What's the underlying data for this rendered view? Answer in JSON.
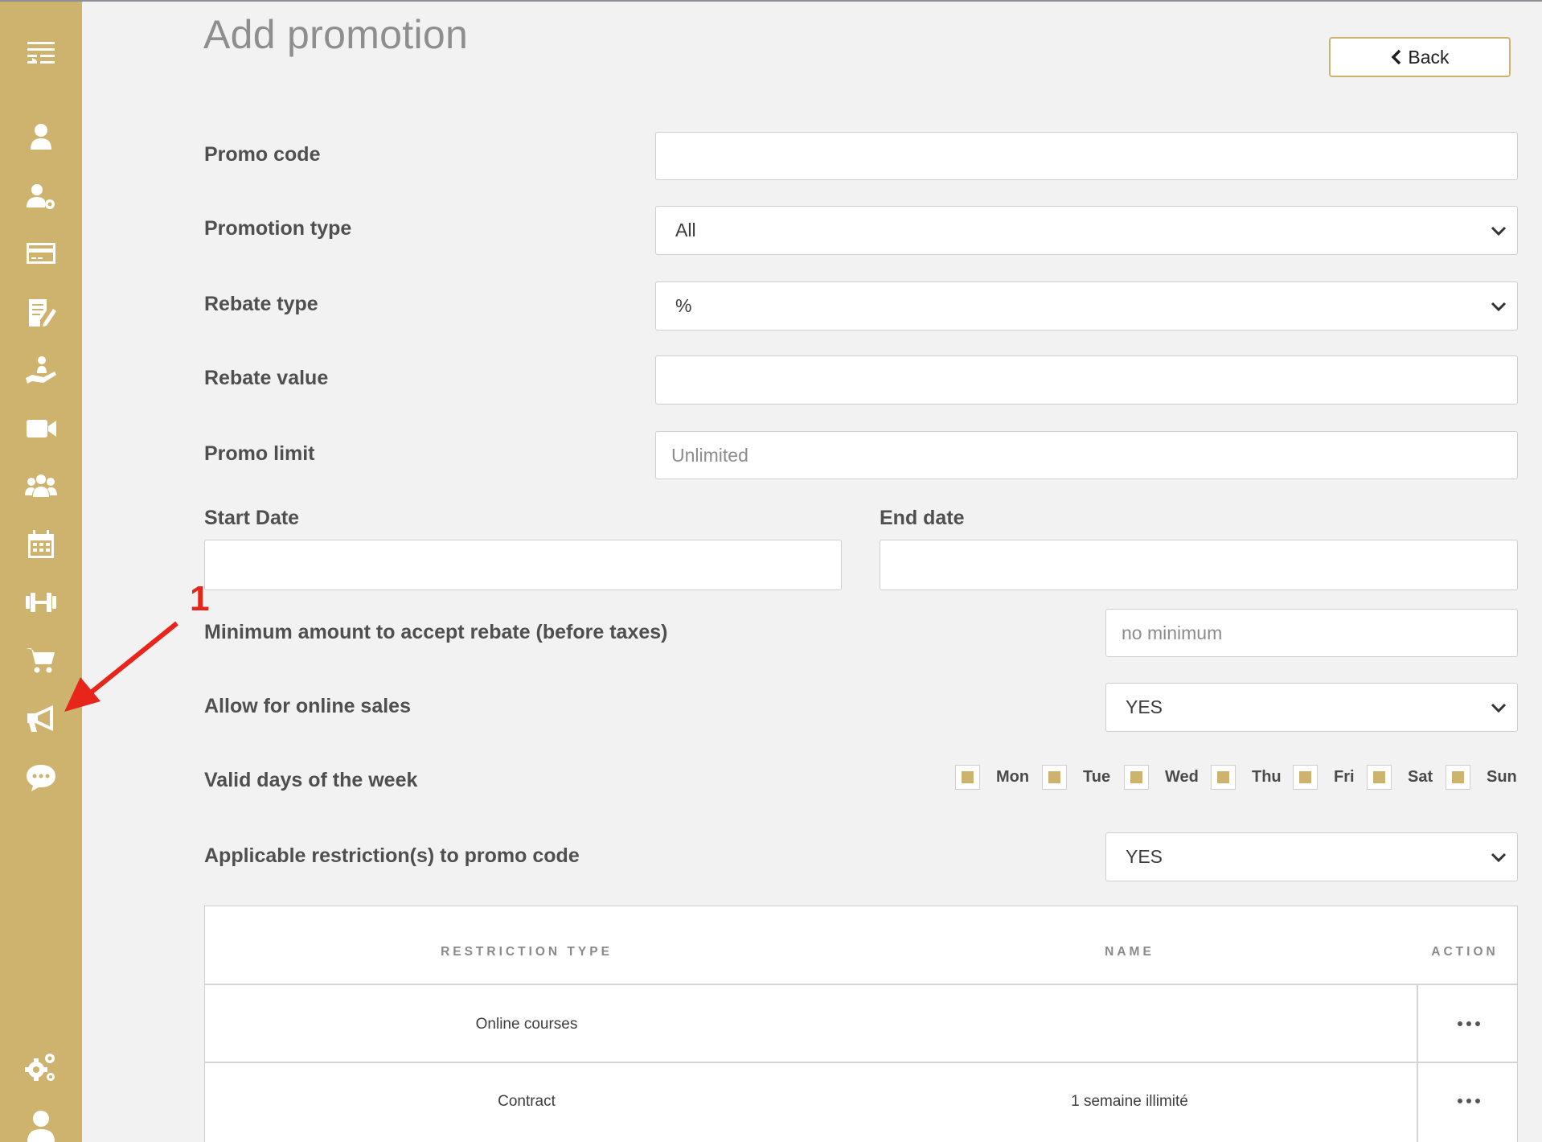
{
  "page": {
    "title": "Add promotion"
  },
  "header": {
    "back_label": "Back"
  },
  "sidebar": {
    "items": [
      {
        "icon": "menu-toggle-icon"
      },
      {
        "icon": "user-icon"
      },
      {
        "icon": "user-settings-icon"
      },
      {
        "icon": "credit-card-icon"
      },
      {
        "icon": "edit-document-icon"
      },
      {
        "icon": "hand-holding-person-icon"
      },
      {
        "icon": "video-camera-icon"
      },
      {
        "icon": "group-icon"
      },
      {
        "icon": "calendar-icon"
      },
      {
        "icon": "dumbbell-icon"
      },
      {
        "icon": "shopping-cart-icon"
      },
      {
        "icon": "megaphone-icon"
      },
      {
        "icon": "chat-bubble-icon"
      },
      {
        "icon": "gears-icon"
      },
      {
        "icon": "account-icon"
      }
    ],
    "accent_color": "#cdb36e"
  },
  "form": {
    "promo_code": {
      "label": "Promo code",
      "value": ""
    },
    "promotion_type": {
      "label": "Promotion type",
      "value": "All"
    },
    "rebate_type": {
      "label": "Rebate type",
      "value": "%"
    },
    "rebate_value": {
      "label": "Rebate value",
      "value": ""
    },
    "promo_limit": {
      "label": "Promo limit",
      "placeholder": "Unlimited"
    },
    "start_date": {
      "label": "Start Date",
      "value": ""
    },
    "end_date": {
      "label": "End date",
      "value": ""
    },
    "minimum_amount": {
      "label": "Minimum amount to accept rebate (before taxes)",
      "placeholder": "no minimum"
    },
    "online_sales": {
      "label": "Allow for online sales",
      "value": "YES"
    },
    "valid_days": {
      "label": "Valid days of the week",
      "days": [
        "Mon",
        "Tue",
        "Wed",
        "Thu",
        "Fri",
        "Sat",
        "Sun"
      ]
    },
    "restrictions": {
      "label": "Applicable restriction(s) to promo code",
      "value": "YES"
    }
  },
  "table": {
    "headers": [
      "RESTRICTION TYPE",
      "NAME",
      "ACTION"
    ],
    "rows": [
      {
        "type": "Online courses",
        "name": ""
      },
      {
        "type": "Contract",
        "name": "1 semaine illimité"
      }
    ]
  },
  "annotation": {
    "number": "1",
    "color": "#e8251b"
  }
}
